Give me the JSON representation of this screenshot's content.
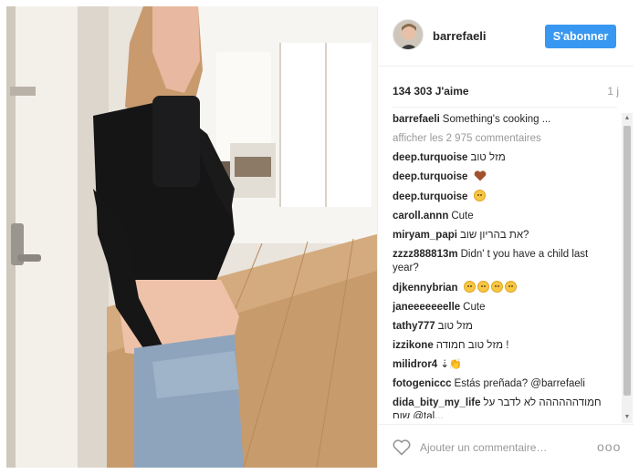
{
  "post": {
    "username": "barrefaeli",
    "follow_label": "S'abonner",
    "likes": "134 303 J'aime",
    "time": "1 j",
    "caption": {
      "user": "barrefaeli",
      "text": "Something's cooking ..."
    },
    "view_all": "afficher les 2 975 commentaires"
  },
  "comments": [
    {
      "user": "deep.turquoise",
      "text": "מזל טוב"
    },
    {
      "user": "deep.turquoise",
      "text": "",
      "icon": "heart-icon"
    },
    {
      "user": "deep.turquoise",
      "text": "",
      "icon": "emoji-icon",
      "count": 1
    },
    {
      "user": "caroll.annn",
      "text": "Cute"
    },
    {
      "user": "miryam_papi",
      "text": "את בהריון שוב?"
    },
    {
      "user": "zzzz888813m",
      "text": "Didn' t you have a child last year?"
    },
    {
      "user": "djkennybrian",
      "text": "",
      "icon": "emoji-icon",
      "count": 4
    },
    {
      "user": "janeeeeeeelle",
      "text": "Cute"
    },
    {
      "user": "tathy777",
      "text": "מזל טוב"
    },
    {
      "user": "izzikone",
      "text": "מזל טוב חמודה !"
    },
    {
      "user": "milidror4",
      "text": "⇣👏"
    },
    {
      "user": "fotogeniccc",
      "text": "Estás preñada? @barrefaeli"
    },
    {
      "user": "dida_bity_my_life",
      "text": "חמודהההההה לא לדבר על שום @tal..."
    }
  ],
  "footer": {
    "placeholder": "Ajouter un commentaire…",
    "more": "ooo"
  },
  "colors": {
    "accent": "#3897f0",
    "muted": "#999999",
    "border": "#efefef"
  }
}
